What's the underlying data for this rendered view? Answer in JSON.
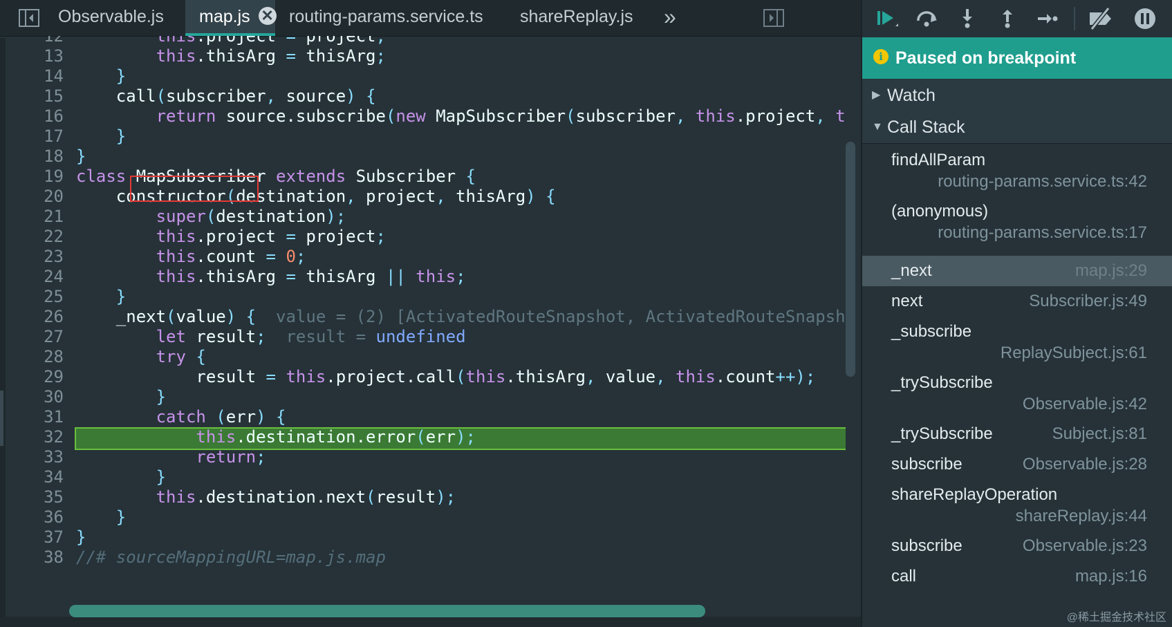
{
  "tabs": [
    {
      "label": "Observable.js",
      "active": false
    },
    {
      "label": "map.js",
      "active": true,
      "close": "✕"
    },
    {
      "label": "routing-params.service.ts",
      "active": false
    },
    {
      "label": "shareReplay.js",
      "active": false
    }
  ],
  "tab_overflow_icon": "»",
  "icons": {
    "navigator_toggle": "sidebar-left-icon",
    "debugger_toggle": "sidebar-right-icon",
    "resume": "resume-icon",
    "step_over": "step-over-icon",
    "step_into": "step-into-icon",
    "step_out": "step-out-icon",
    "step": "step-icon",
    "deactivate_breakpoints": "deactivate-breakpoints-icon",
    "pause_on_exceptions": "pause-icon"
  },
  "code": {
    "breakpoint_line": 29,
    "highlight_color": "#3b7a34",
    "lines": [
      {
        "n": "12",
        "text": "        this.project = project;"
      },
      {
        "n": "13",
        "text": "        this.thisArg = thisArg;"
      },
      {
        "n": "14",
        "text": "    }"
      },
      {
        "n": "15",
        "text": "    call(subscriber, source) {"
      },
      {
        "n": "16",
        "text": "        return source.subscribe(new MapSubscriber(subscriber, this.project, th"
      },
      {
        "n": "17",
        "text": "    }"
      },
      {
        "n": "18",
        "text": "}"
      },
      {
        "n": "19",
        "text": "class MapSubscriber extends Subscriber {"
      },
      {
        "n": "20",
        "text": "    constructor(destination, project, thisArg) {"
      },
      {
        "n": "21",
        "text": "        super(destination);"
      },
      {
        "n": "22",
        "text": "        this.project = project;"
      },
      {
        "n": "23",
        "text": "        this.count = 0;"
      },
      {
        "n": "24",
        "text": "        this.thisArg = thisArg || this;"
      },
      {
        "n": "25",
        "text": "    }"
      },
      {
        "n": "26",
        "text": "    _next(value) {"
      },
      {
        "n": "27",
        "text": "        let result;"
      },
      {
        "n": "28",
        "text": "        try {"
      },
      {
        "n": "29",
        "text": "            result = this.project.call(this.thisArg, value, this.count++);"
      },
      {
        "n": "30",
        "text": "        }"
      },
      {
        "n": "31",
        "text": "        catch (err) {"
      },
      {
        "n": "32",
        "text": "            this.destination.error(err);"
      },
      {
        "n": "33",
        "text": "            return;"
      },
      {
        "n": "34",
        "text": "        }"
      },
      {
        "n": "35",
        "text": "        this.destination.next(result);"
      },
      {
        "n": "36",
        "text": "    }"
      },
      {
        "n": "37",
        "text": "}"
      },
      {
        "n": "38",
        "text": "//# sourceMappingURL=map.js.map"
      }
    ],
    "inline_values": {
      "line26": "value = (2) [ActivatedRouteSnapshot, ActivatedRouteSnapsh",
      "line27_name": "result = ",
      "line27_value": "undefined"
    }
  },
  "debugger": {
    "status": "Paused on breakpoint",
    "status_icon": "i",
    "watch_label": "Watch",
    "callstack_label": "Call Stack",
    "frames": [
      {
        "fn": "findAllParam",
        "loc": "routing-params.service.ts:42"
      },
      {
        "fn": "(anonymous)",
        "loc": "routing-params.service.ts:17"
      },
      {
        "fn": "_next",
        "loc": "map.js:29"
      },
      {
        "fn": "next",
        "loc": "Subscriber.js:49"
      },
      {
        "fn": "_subscribe",
        "loc": "ReplaySubject.js:61"
      },
      {
        "fn": "_trySubscribe",
        "loc": "Observable.js:42"
      },
      {
        "fn": "_trySubscribe",
        "loc": "Subject.js:81"
      },
      {
        "fn": "subscribe",
        "loc": "Observable.js:28"
      },
      {
        "fn": "shareReplayOperation",
        "loc": "shareReplay.js:44"
      },
      {
        "fn": "subscribe",
        "loc": "Observable.js:23"
      },
      {
        "fn": "call",
        "loc": "map.js:16"
      }
    ]
  },
  "watermark": "@稀土掘金技术社区"
}
